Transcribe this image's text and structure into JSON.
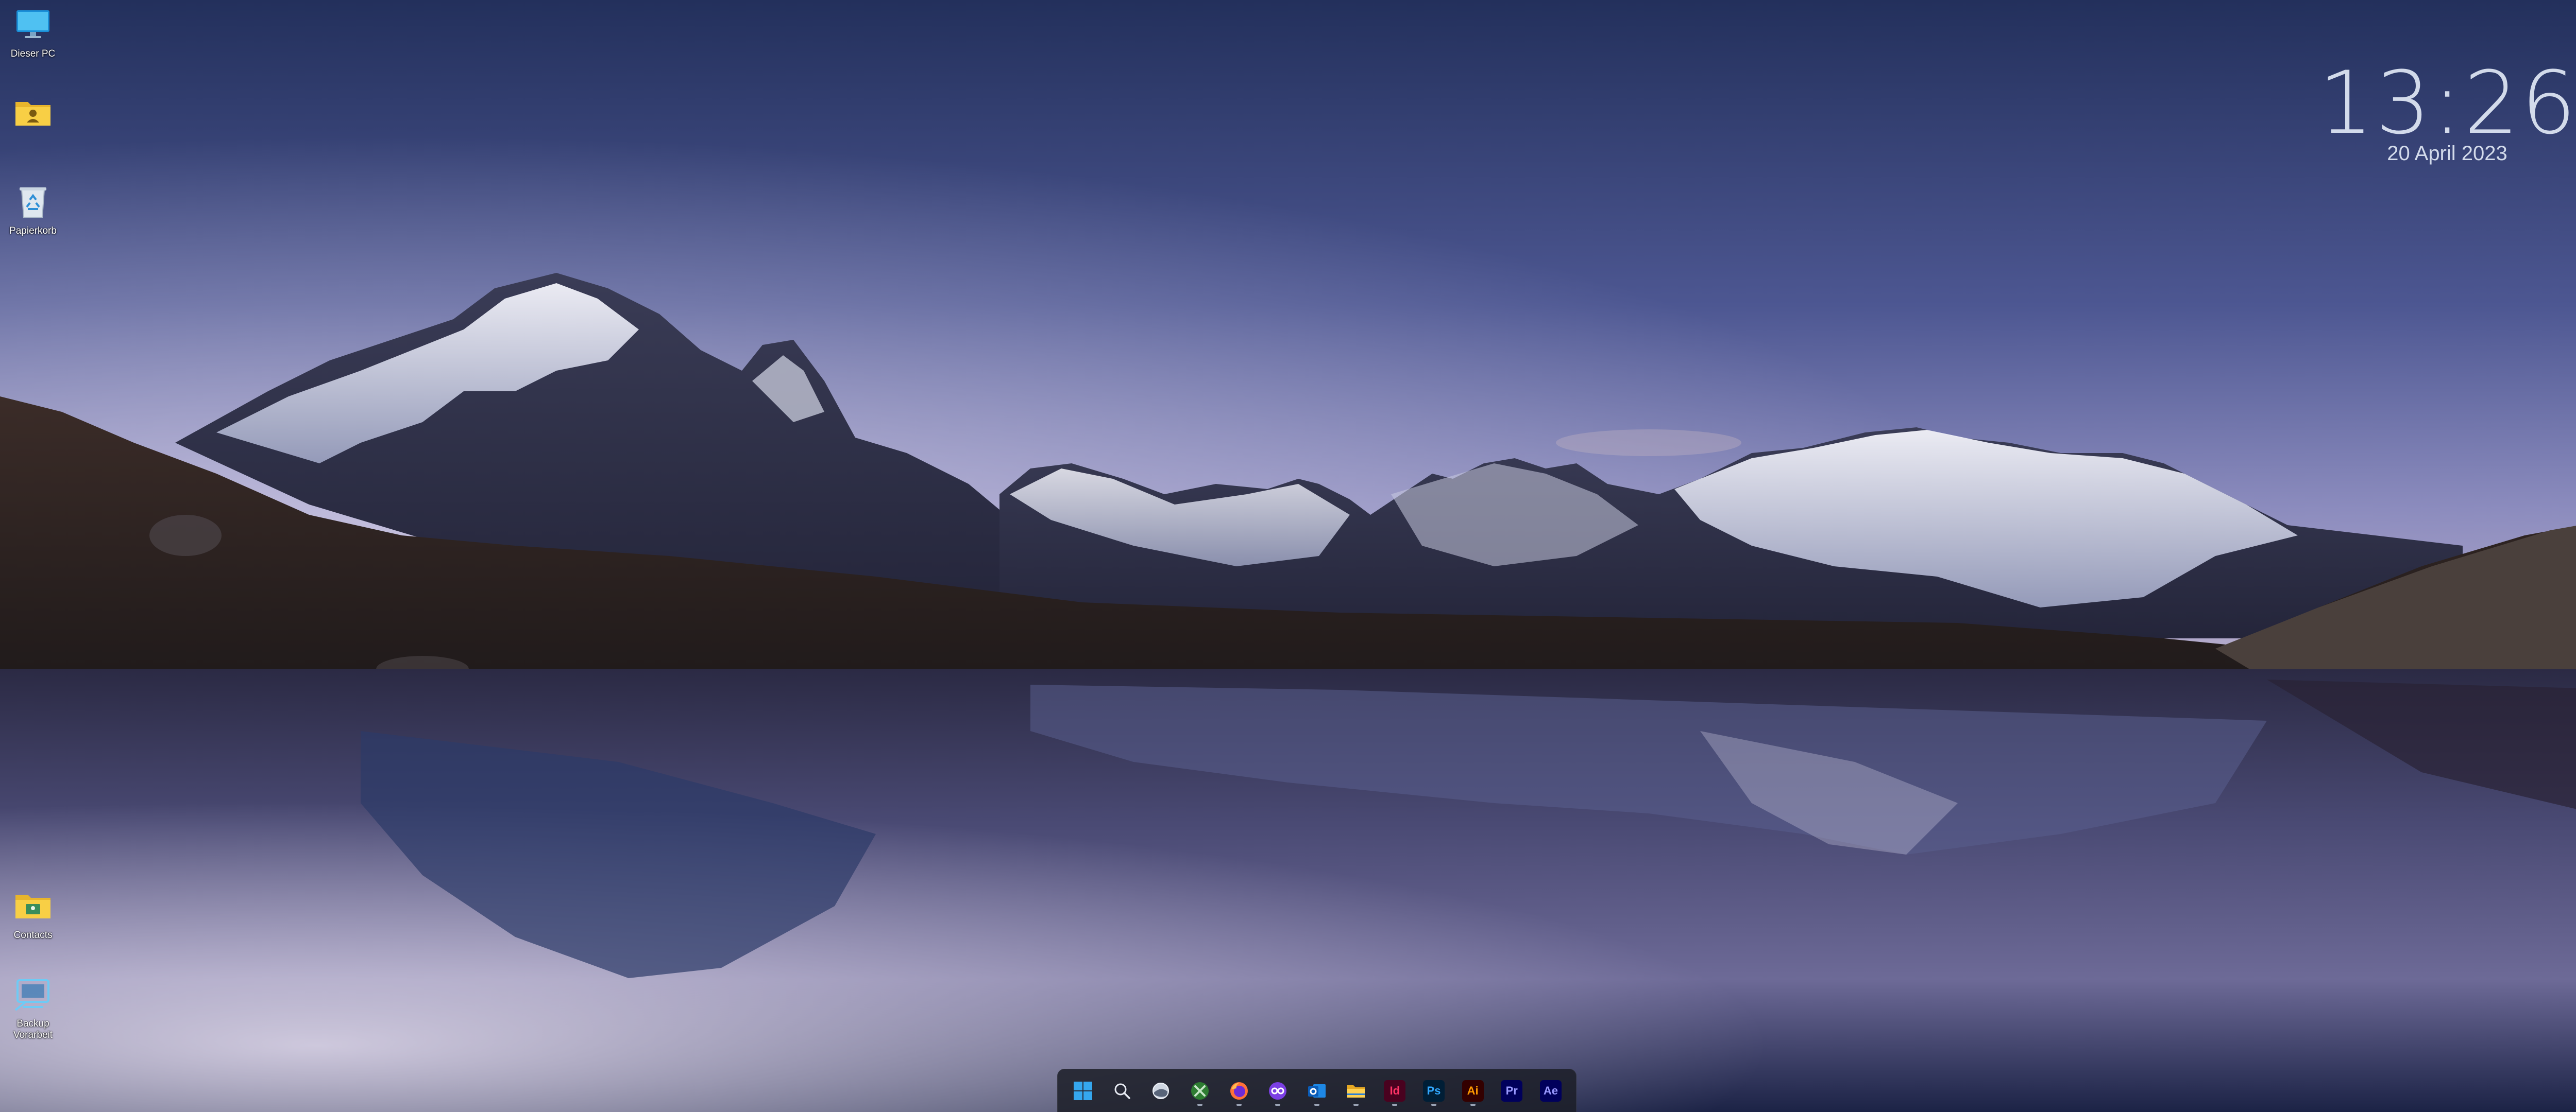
{
  "desktop": {
    "icons": [
      {
        "name": "this-pc",
        "label": "Dieser PC",
        "icon": "monitor-icon"
      },
      {
        "name": "user-folder",
        "label": "",
        "icon": "user-folder-icon"
      },
      {
        "name": "recycle-bin",
        "label": "Papierkorb",
        "icon": "recycle-bin-icon"
      },
      {
        "name": "contacts",
        "label": "Contacts",
        "icon": "contacts-folder-icon"
      },
      {
        "name": "backup",
        "label": "Backup Vorarbeit",
        "icon": "backup-icon"
      }
    ]
  },
  "clock": {
    "time": "13:26",
    "date": "20 April 2023"
  },
  "taskbar": {
    "items": [
      {
        "name": "start",
        "icon": "windows-logo-icon",
        "running": false
      },
      {
        "name": "search",
        "icon": "search-icon",
        "running": false
      },
      {
        "name": "task-view",
        "icon": "task-view-icon",
        "running": false
      },
      {
        "name": "xbox",
        "icon": "xbox-app-icon",
        "running": true
      },
      {
        "name": "firefox",
        "icon": "firefox-icon",
        "running": true
      },
      {
        "name": "app-purple",
        "icon": "purple-app-icon",
        "running": true
      },
      {
        "name": "outlook",
        "icon": "outlook-icon",
        "running": true
      },
      {
        "name": "file-explorer",
        "icon": "folder-icon",
        "running": true
      },
      {
        "name": "indesign",
        "icon": "indesign-icon",
        "label": "Id",
        "running": true
      },
      {
        "name": "photoshop",
        "icon": "photoshop-icon",
        "label": "Ps",
        "running": true
      },
      {
        "name": "illustrator",
        "icon": "illustrator-icon",
        "label": "Ai",
        "running": true
      },
      {
        "name": "premiere",
        "icon": "premiere-icon",
        "label": "Pr",
        "running": false
      },
      {
        "name": "after-effects",
        "icon": "after-effects-icon",
        "label": "Ae",
        "running": false
      }
    ]
  },
  "colors": {
    "sky_top": "#2a3866",
    "sky_horizon": "#a9a8cc",
    "water_light": "#bbb5d3",
    "indesign": "#ff3366",
    "photoshop": "#31a8ff",
    "illustrator": "#ff9a00",
    "premiere": "#9999ff",
    "after_effects": "#9999ff"
  }
}
